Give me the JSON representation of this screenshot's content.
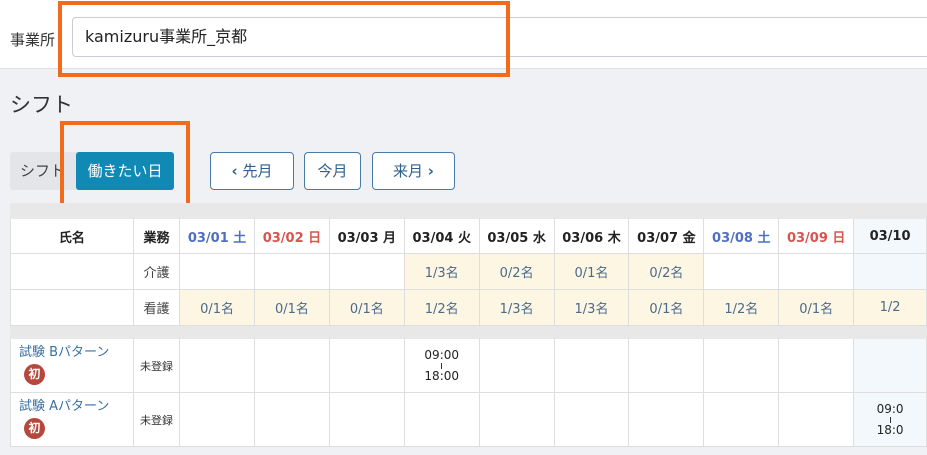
{
  "office": {
    "label": "事業所",
    "value": "kamizuru事業所_京都"
  },
  "page": {
    "title": "シフト"
  },
  "tabs": {
    "shift": "シフト",
    "want_days": "働きたい日"
  },
  "nav": {
    "prev": "先月",
    "current": "今月",
    "next": "来月"
  },
  "table": {
    "headers": {
      "name": "氏名",
      "role": "業務"
    },
    "dates": [
      "03/01 土",
      "03/02 日",
      "03/03 月",
      "03/04 火",
      "03/05 水",
      "03/06 木",
      "03/07 金",
      "03/08 土",
      "03/09 日",
      "03/10"
    ],
    "capacity": [
      {
        "role": "介護",
        "values": [
          "",
          "",
          "",
          "1/3名",
          "0/2名",
          "0/1名",
          "0/2名",
          "",
          "",
          ""
        ]
      },
      {
        "role": "看護",
        "values": [
          "0/1名",
          "0/1名",
          "0/1名",
          "1/2名",
          "1/3名",
          "1/3名",
          "0/1名",
          "1/2名",
          "0/1名",
          "1/2"
        ]
      }
    ],
    "staff": [
      {
        "name": "試験 Bパターン",
        "badge": "初",
        "status": "未登録",
        "shifts": [
          "",
          "",
          "",
          {
            "start": "09:00",
            "end": "18:00"
          },
          "",
          "",
          "",
          "",
          "",
          ""
        ]
      },
      {
        "name": "試験 Aパターン",
        "badge": "初",
        "status": "未登録",
        "shifts": [
          "",
          "",
          "",
          "",
          "",
          "",
          "",
          "",
          "",
          {
            "start": "09:0",
            "end": "18:0"
          }
        ]
      }
    ]
  },
  "colors": {
    "accent": "#1189b5",
    "highlight": "#f26a1b",
    "saturday": "#4f6fc1",
    "sunday": "#d9534f",
    "badge": "#b6473d"
  }
}
